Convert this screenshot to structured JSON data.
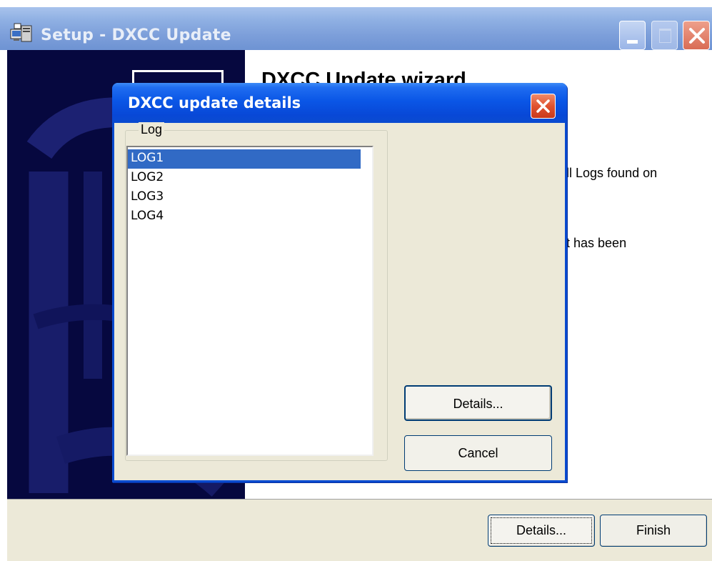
{
  "window": {
    "title": "Setup - DXCC Update",
    "welcome_heading": "DXCC Update wizard",
    "body_text_1": "all Logs found on",
    "body_text_2": "at has been"
  },
  "footer": {
    "details_label": "Details...",
    "finish_label": "Finish"
  },
  "dialog": {
    "title": "DXCC update details",
    "group_label": "Log",
    "logs": [
      "LOG1",
      "LOG2",
      "LOG3",
      "LOG4"
    ],
    "selected_index": 0,
    "details_label": "Details...",
    "cancel_label": "Cancel"
  },
  "icons": {
    "app": "setup-computer-icon",
    "minimize": "minimize-icon",
    "maximize": "maximize-icon",
    "close": "close-icon"
  },
  "colors": {
    "selection": "#316ac5",
    "dialog_titlebar": "#0a56e6",
    "sidebar": "#06083f"
  }
}
